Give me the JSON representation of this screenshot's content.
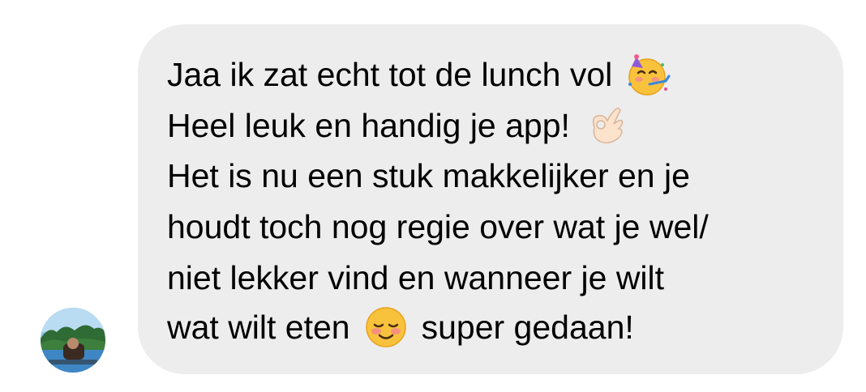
{
  "conversation": {
    "message": {
      "lines": [
        "Jaa ik zat echt tot de lunch vol",
        "Heel leuk en handig je app!",
        "Het is nu een stuk makkelijker en je",
        "houdt toch nog regie over wat je wel/",
        "niet lekker vind en wanneer je wilt",
        "wat wilt eten",
        "super gedaan!"
      ],
      "emojis": [
        "partying-face-icon",
        "ok-hand-icon",
        "smiling-face-icon"
      ]
    },
    "sender_avatar": "avatar-photo"
  },
  "colors": {
    "bubble_background": "#ededed",
    "text": "#000000",
    "page_background": "#ffffff"
  }
}
